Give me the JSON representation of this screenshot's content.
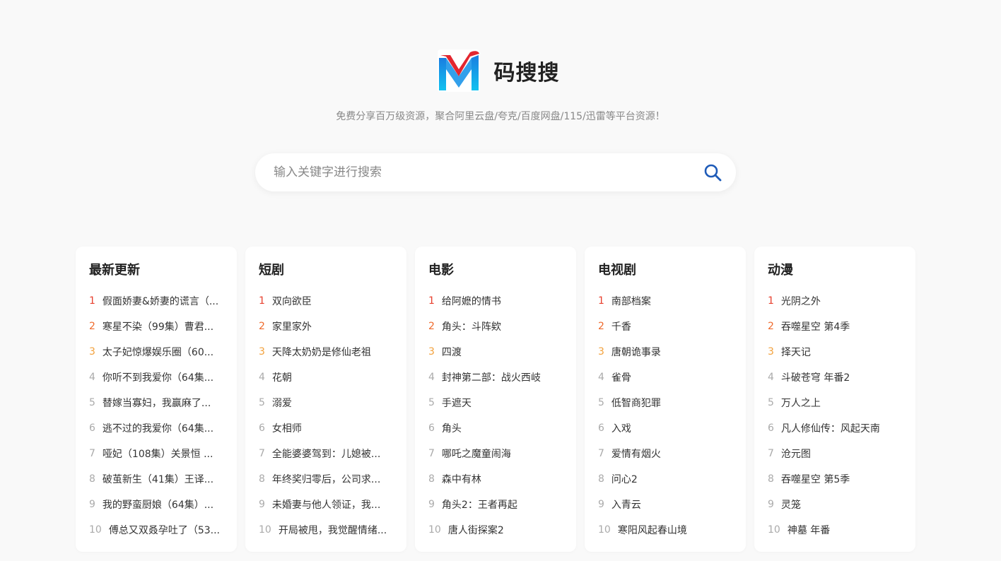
{
  "brand": {
    "name": "码搜搜",
    "tagline": "免费分享百万级资源，聚合阿里云盘/夸克/百度网盘/115/迅雷等平台资源！"
  },
  "search": {
    "placeholder": "输入关键字进行搜索"
  },
  "colors": {
    "rank1": "#e8402e",
    "rank2": "#ef6a2c",
    "rank3": "#f2a13c",
    "search_icon": "#1e5bb8"
  },
  "cards": [
    {
      "title": "最新更新",
      "items": [
        {
          "rank": "1",
          "text": "假面娇妻&娇妻的谎言（..."
        },
        {
          "rank": "2",
          "text": "寒星不染（99集）曹君..."
        },
        {
          "rank": "3",
          "text": "太子妃惊爆娱乐圈（60..."
        },
        {
          "rank": "4",
          "text": "你听不到我爱你（64集..."
        },
        {
          "rank": "5",
          "text": "替嫁当寡妇，我赢麻了..."
        },
        {
          "rank": "6",
          "text": "逃不过的我爱你（64集..."
        },
        {
          "rank": "7",
          "text": "哑妃（108集）关景恒 ..."
        },
        {
          "rank": "8",
          "text": "破茧新生（41集）王译..."
        },
        {
          "rank": "9",
          "text": "我的野蛮厨娘（64集）..."
        },
        {
          "rank": "10",
          "text": "傅总又双叒孕吐了（53..."
        }
      ]
    },
    {
      "title": "短剧",
      "items": [
        {
          "rank": "1",
          "text": "双向欲臣"
        },
        {
          "rank": "2",
          "text": "家里家外"
        },
        {
          "rank": "3",
          "text": "天降太奶奶是修仙老祖"
        },
        {
          "rank": "4",
          "text": "花朝"
        },
        {
          "rank": "5",
          "text": "溺爱"
        },
        {
          "rank": "6",
          "text": "女相师"
        },
        {
          "rank": "7",
          "text": "全能婆婆驾到：儿媳被..."
        },
        {
          "rank": "8",
          "text": "年终奖归零后，公司求..."
        },
        {
          "rank": "9",
          "text": "未婚妻与他人领证，我..."
        },
        {
          "rank": "10",
          "text": "开局被甩，我觉醒情绪..."
        }
      ]
    },
    {
      "title": "电影",
      "items": [
        {
          "rank": "1",
          "text": "给阿嬷的情书"
        },
        {
          "rank": "2",
          "text": "角头：斗阵欸"
        },
        {
          "rank": "3",
          "text": "四渡"
        },
        {
          "rank": "4",
          "text": "封神第二部：战火西岐"
        },
        {
          "rank": "5",
          "text": "手遮天"
        },
        {
          "rank": "6",
          "text": "角头"
        },
        {
          "rank": "7",
          "text": "哪吒之魔童闹海"
        },
        {
          "rank": "8",
          "text": "森中有林"
        },
        {
          "rank": "9",
          "text": "角头2：王者再起"
        },
        {
          "rank": "10",
          "text": "唐人街探案2"
        }
      ]
    },
    {
      "title": "电视剧",
      "items": [
        {
          "rank": "1",
          "text": "南部档案"
        },
        {
          "rank": "2",
          "text": "千香"
        },
        {
          "rank": "3",
          "text": "唐朝诡事录"
        },
        {
          "rank": "4",
          "text": "雀骨"
        },
        {
          "rank": "5",
          "text": "低智商犯罪"
        },
        {
          "rank": "6",
          "text": "入戏"
        },
        {
          "rank": "7",
          "text": "爱情有烟火"
        },
        {
          "rank": "8",
          "text": "问心2"
        },
        {
          "rank": "9",
          "text": "入青云"
        },
        {
          "rank": "10",
          "text": "寒阳风起春山境"
        }
      ]
    },
    {
      "title": "动漫",
      "items": [
        {
          "rank": "1",
          "text": "光阴之外"
        },
        {
          "rank": "2",
          "text": "吞噬星空 第4季"
        },
        {
          "rank": "3",
          "text": "择天记"
        },
        {
          "rank": "4",
          "text": "斗破苍穹 年番2"
        },
        {
          "rank": "5",
          "text": "万人之上"
        },
        {
          "rank": "6",
          "text": "凡人修仙传：风起天南"
        },
        {
          "rank": "7",
          "text": "沧元图"
        },
        {
          "rank": "8",
          "text": "吞噬星空 第5季"
        },
        {
          "rank": "9",
          "text": "灵笼"
        },
        {
          "rank": "10",
          "text": "神墓 年番"
        }
      ]
    }
  ]
}
